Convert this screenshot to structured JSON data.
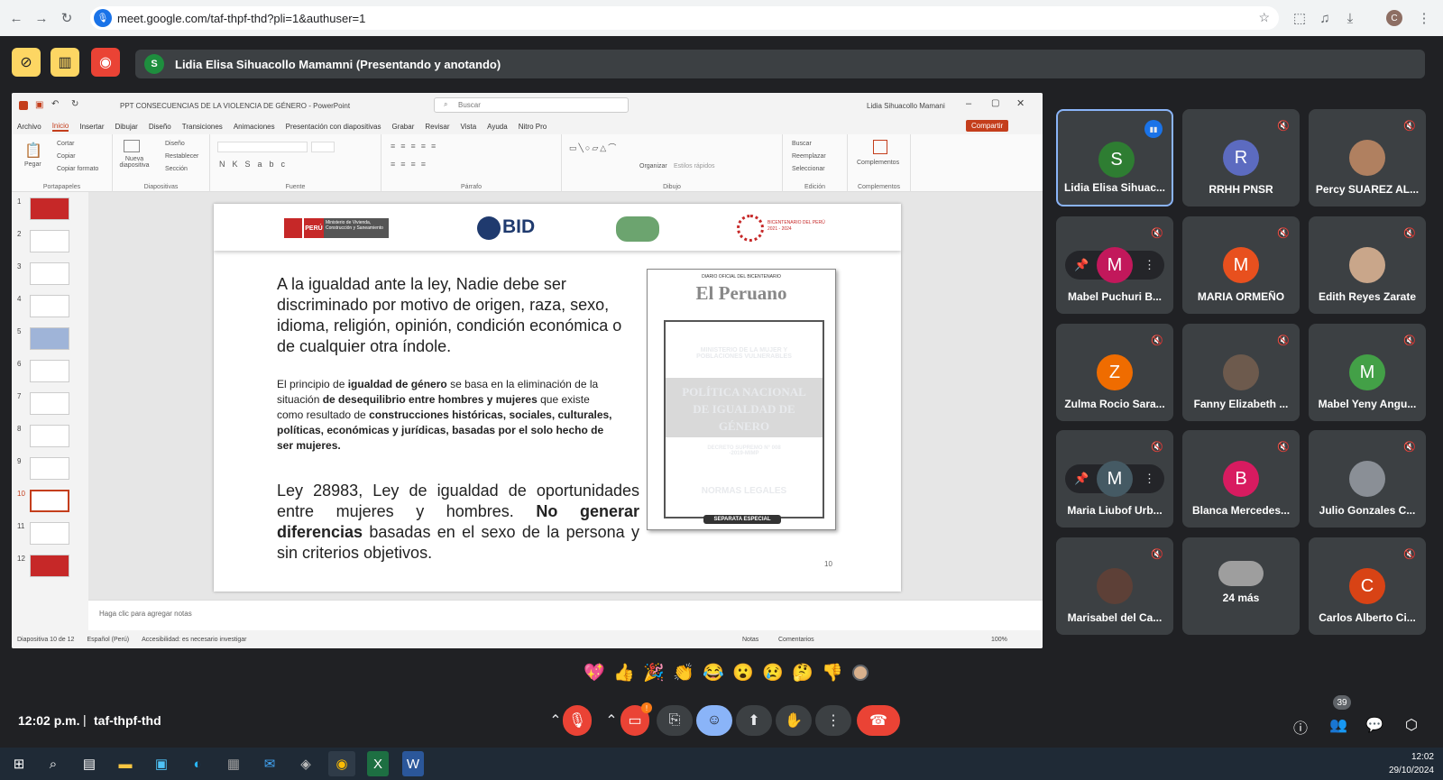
{
  "browser": {
    "url": "meet.google.com/taf-thpf-thd?pli=1&authuser=1",
    "profile_initial": "C"
  },
  "meet": {
    "presenter_initial": "S",
    "presenter_label": "Lidia Elisa Sihuacollo Mamamni (Presentando y anotando)",
    "time": "12:02 p.m.",
    "separator": "|",
    "meeting_code": "taf-thpf-thd",
    "people_count": "39",
    "reactions": [
      "💖",
      "👍",
      "🎉",
      "👏",
      "😂",
      "😮",
      "😢",
      "🤔",
      "👎"
    ],
    "participants": [
      {
        "name": "Lidia Elisa Sihuac...",
        "initial": "S",
        "color": "#2e7d32",
        "type": "letter"
      },
      {
        "name": "RRHH PNSR",
        "initial": "R",
        "color": "#5c6bc0",
        "type": "letter"
      },
      {
        "name": "Percy SUAREZ AL...",
        "initial": "",
        "color": "#b08060",
        "type": "photo"
      },
      {
        "name": "Mabel Puchuri B...",
        "initial": "M",
        "color": "#c2185b",
        "type": "letter"
      },
      {
        "name": "MARIA ORMEÑO",
        "initial": "M",
        "color": "#e8501e",
        "type": "letter"
      },
      {
        "name": "Edith Reyes Zarate",
        "initial": "",
        "color": "#c9a68a",
        "type": "photo"
      },
      {
        "name": "Zulma Rocio Sara...",
        "initial": "Z",
        "color": "#ef6c00",
        "type": "letter"
      },
      {
        "name": "Fanny Elizabeth ...",
        "initial": "",
        "color": "#6d5a4d",
        "type": "photo"
      },
      {
        "name": "Mabel Yeny Angu...",
        "initial": "M",
        "color": "#43a047",
        "type": "letter"
      },
      {
        "name": "Maria Liubof Urb...",
        "initial": "M",
        "color": "#455a64",
        "type": "letter"
      },
      {
        "name": "Blanca Mercedes...",
        "initial": "B",
        "color": "#d81b60",
        "type": "letter"
      },
      {
        "name": "Julio Gonzales C...",
        "initial": "",
        "color": "#8a8f96",
        "type": "photo"
      },
      {
        "name": "Marisabel del Ca...",
        "initial": "",
        "color": "#5d4037",
        "type": "photo"
      },
      {
        "name": "24 más",
        "initial": "",
        "color": "#9e9e9e",
        "type": "more"
      },
      {
        "name": "Carlos Alberto Ci...",
        "initial": "C",
        "color": "#d84315",
        "type": "letter"
      }
    ]
  },
  "ppt": {
    "title": "PPT CONSECUENCIAS DE LA VIOLENCIA DE GÉNERO - PowerPoint",
    "search": "Buscar",
    "user": "Lidia Sihuacollo Mamani",
    "tabs": [
      "Archivo",
      "Inicio",
      "Insertar",
      "Dibujar",
      "Diseño",
      "Transiciones",
      "Animaciones",
      "Presentación con diapositivas",
      "Grabar",
      "Revisar",
      "Vista",
      "Ayuda",
      "Nitro Pro"
    ],
    "share": "Compartir",
    "groups": [
      "Portapapeles",
      "Diapositivas",
      "Fuente",
      "Párrafo",
      "Dibujo",
      "Edición",
      "Complementos"
    ],
    "ribbon": {
      "pegar": "Pegar",
      "cortar": "Cortar",
      "copiar": "Copiar",
      "copiar_formato": "Copiar formato",
      "nueva": "Nueva diapositiva",
      "diseno": "Diseño",
      "restablecer": "Restablecer",
      "seccion": "Sección",
      "organizar": "Organizar",
      "estilos": "Estilos rápidos",
      "buscar": "Buscar",
      "reemplazar": "Reemplazar",
      "seleccionar": "Seleccionar",
      "complementos": "Complementos"
    },
    "slide_numbers": [
      "1",
      "2",
      "3",
      "4",
      "5",
      "6",
      "7",
      "8",
      "9",
      "10",
      "11",
      "12"
    ],
    "notes": "Haga clic para agregar notas",
    "status": {
      "slide": "Diapositiva 10 de 12",
      "lang": "Español (Perú)",
      "access": "Accesibilidad: es necesario investigar",
      "notas": "Notas",
      "comentarios": "Comentarios",
      "zoom": "100%"
    },
    "slide": {
      "logo_peru": "PERÚ",
      "logo_ministry": "Ministerio de Vivienda, Construcción y Saneamiento",
      "logo_bid": "BID",
      "logo_bicentenario": "BICENTENARIO DEL PERÚ 2021 - 2024",
      "para1": "A la igualdad ante la ley, Nadie debe ser discriminado por motivo de origen, raza, sexo, idioma, religión, opinión, condición económica o de cualquier otra índole.",
      "para2_a": "El principio de ",
      "para2_b": "igualdad de género",
      "para2_c": " se basa en la eliminación de la situación ",
      "para2_d": "de desequilibrio entre hombres y mujeres",
      "para2_e": " que existe como resultado de ",
      "para2_f": "construcciones históricas, sociales, culturales, políticas, económicas y jurídicas, basadas por el solo hecho de ser mujeres.",
      "para3_a": "Ley 28983, Ley de igualdad de oportunidades entre mujeres y hombres. ",
      "para3_b": "No generar diferencias",
      "para3_c": "  basadas en el sexo de la persona y sin criterios objetivos.",
      "page_number": "10",
      "doc": {
        "header": "DIARIO OFICIAL DEL BICENTENARIO",
        "paper": "El Peruano",
        "ministry": "MINISTERIO DE LA MUJER Y POBLACIONES VULNERABLES",
        "policy": "POLÍTICA NACIONAL DE IGUALDAD DE GÉNERO",
        "decree": "DECRETO SUPREMO N° 008 -2019-MIMP",
        "normas": "NORMAS LEGALES",
        "separata": "SEPARATA ESPECIAL"
      }
    }
  },
  "taskbar": {
    "time": "12:02",
    "date": "29/10/2024"
  }
}
